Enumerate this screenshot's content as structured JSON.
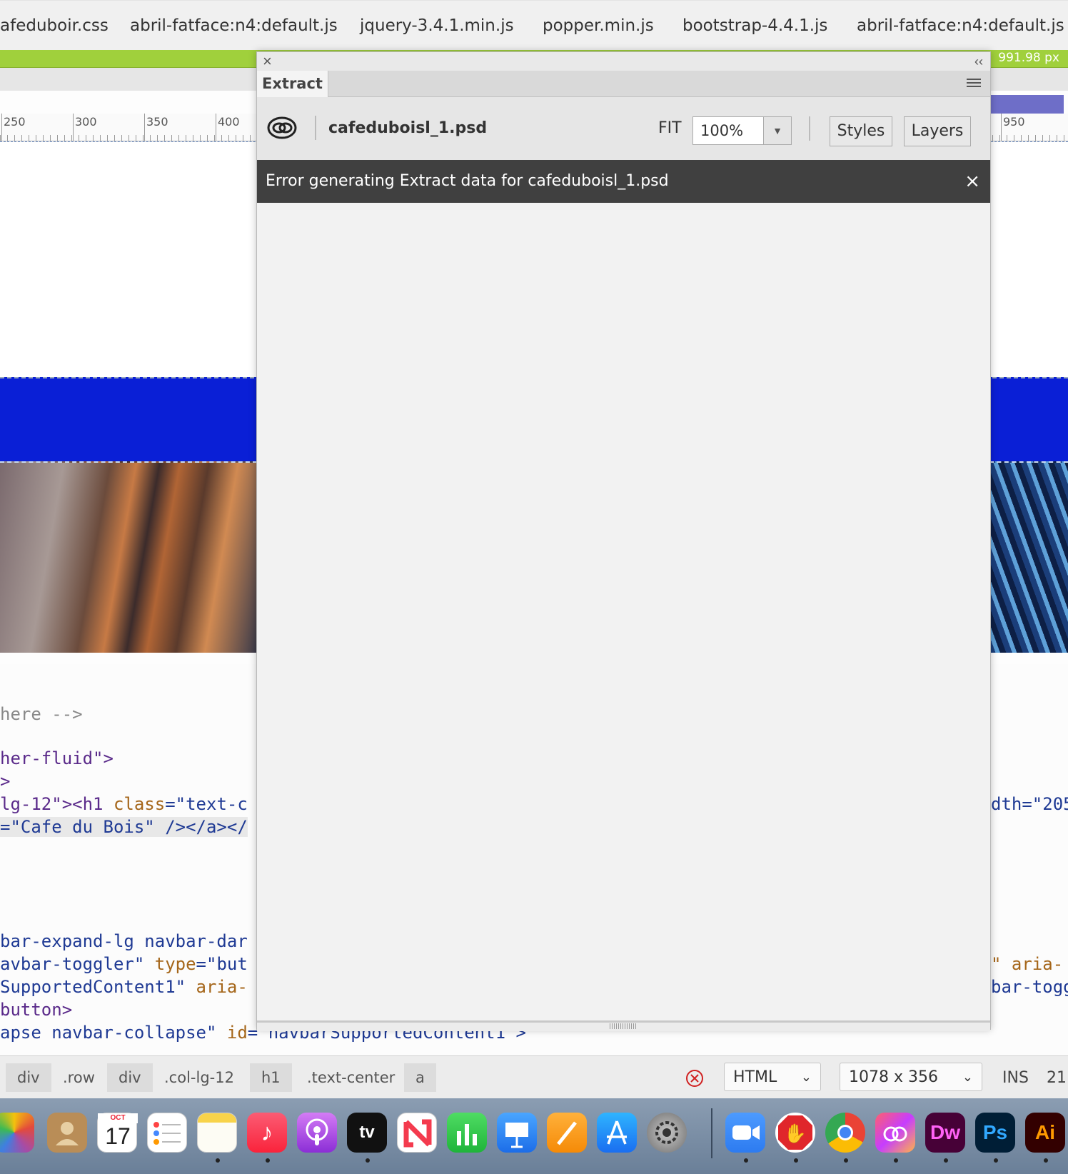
{
  "file_tabs": [
    "afeduboir.css",
    "abril-fatface:n4:default.js",
    "jquery-3.4.1.min.js",
    "popper.min.js",
    "bootstrap-4.4.1.js",
    "abril-fatface:n4:default.js"
  ],
  "media_query": {
    "width_label": "991.98 px"
  },
  "ruler": {
    "labels": [
      "250",
      "300",
      "350",
      "400",
      "950"
    ]
  },
  "code_lines": {
    "l1": "here -->",
    "l2": "her-fluid\">",
    "l3": ">",
    "l4a": "lg-12\"><h1 ",
    "l4b": "class",
    "l4c": "=\"text-c",
    "l4r": "dth=\"205",
    "l5": "=\"Cafe du Bois\" /></a></",
    "l6": "bar-expand-lg navbar-dar",
    "l7a": "avbar-toggler\" ",
    "l7b": "type",
    "l7c": "=\"but",
    "l7r": "\" aria-",
    "l8a": "SupportedContent1\" ",
    "l8b": "aria-",
    "l8r": "bar-togg",
    "l9": "button>",
    "l10a": "apse navbar-collapse\" ",
    "l10b": "id",
    "l10c": "=\"navbarSupportedContent1\">"
  },
  "extract_panel": {
    "tab_label": "Extract",
    "file_name": "cafeduboisl_1.psd",
    "fit_label": "FIT",
    "zoom_value": "100%",
    "styles_button": "Styles",
    "layers_button": "Layers",
    "error_message": "Error generating Extract data for cafeduboisl_1.psd"
  },
  "status_bar": {
    "breadcrumbs": [
      "div",
      ".row",
      "div",
      ".col-lg-12",
      "h1",
      ".text-center",
      "a"
    ],
    "doc_type": "HTML",
    "dimensions": "1078 x 356",
    "mode": "INS",
    "line": "21"
  },
  "dock": {
    "calendar_month": "OCT",
    "calendar_day": "17",
    "tv_label": "tv",
    "dw_label": "Dw",
    "ps_label": "Ps",
    "ai_label": "Ai"
  },
  "colors": {
    "green_bar": "#a0d03c",
    "blue_band": "#0a1fd6",
    "error_bar": "#404040"
  }
}
